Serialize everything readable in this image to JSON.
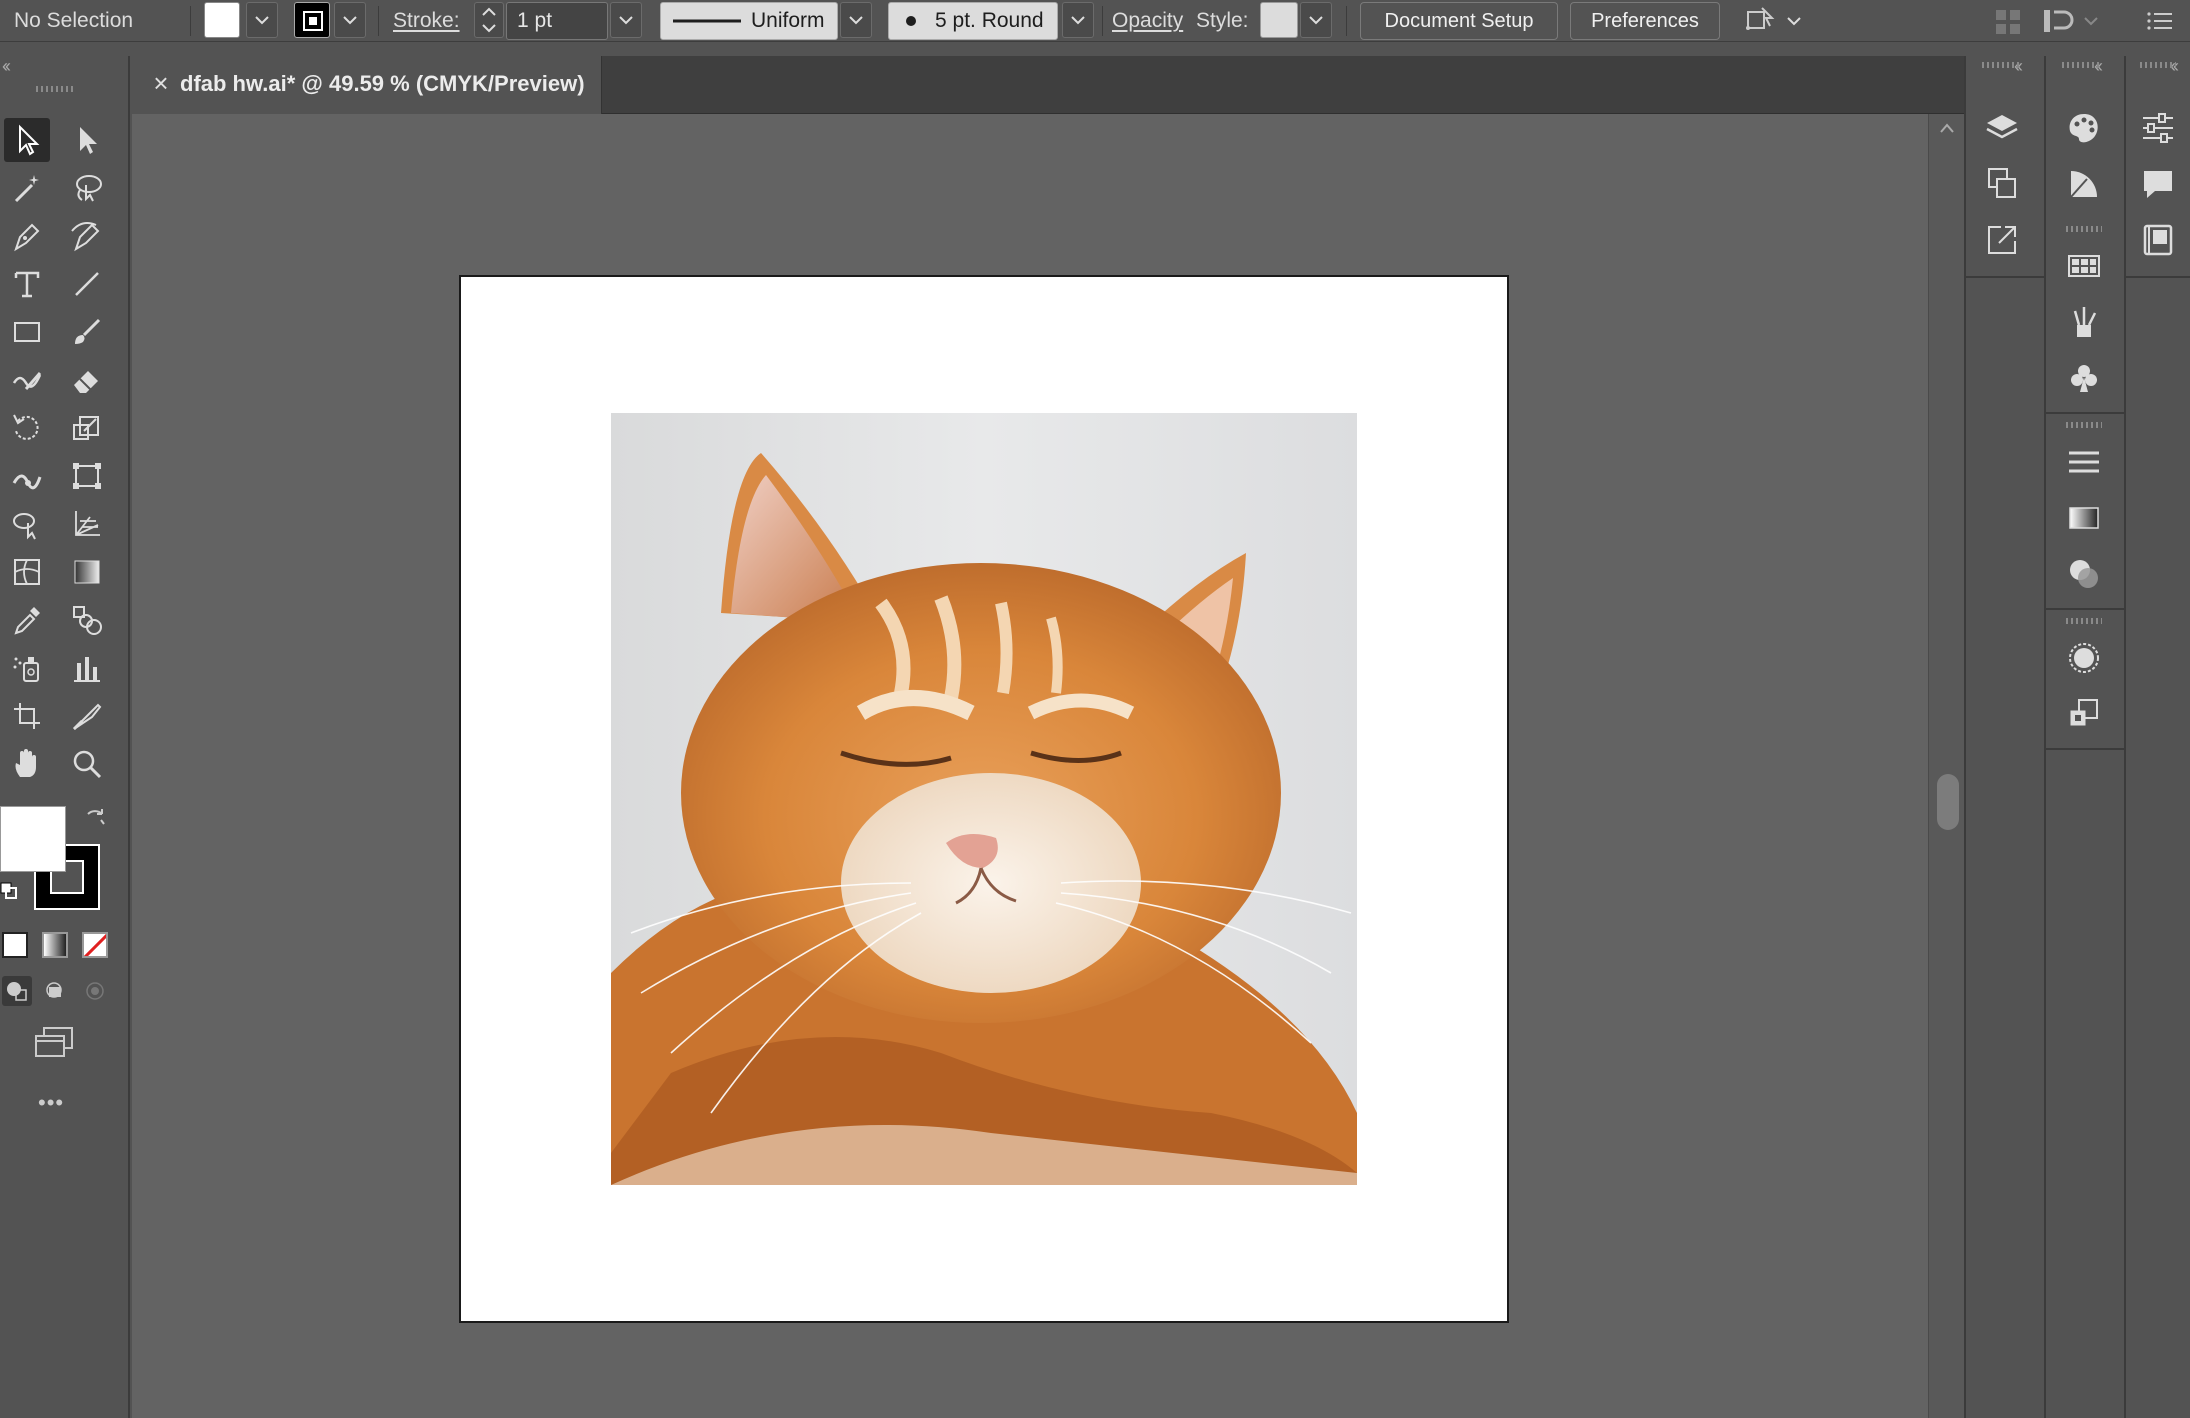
{
  "control_bar": {
    "selection_status": "No Selection",
    "fill_color": "#ffffff",
    "stroke_label": "Stroke:",
    "stroke_weight": "1 pt",
    "variable_width_profile": "Uniform",
    "brush_definition": "5 pt. Round",
    "opacity_label": "Opacity",
    "style_label": "Style:",
    "document_setup_label": "Document Setup",
    "preferences_label": "Preferences"
  },
  "document_tab": {
    "title": "dfab hw.ai* @ 49.59 % (CMYK/Preview)",
    "close_glyph": "×"
  },
  "toolbar": {
    "collapse_glyph": "‹‹",
    "more_tools_glyph": "•••",
    "tools": [
      {
        "name": "selection-tool",
        "icon": "black-arrow"
      },
      {
        "name": "direct-selection-tool",
        "icon": "white-arrow"
      },
      {
        "name": "magic-wand-tool",
        "icon": "magic-wand"
      },
      {
        "name": "lasso-tool",
        "icon": "lasso"
      },
      {
        "name": "pen-tool",
        "icon": "pen"
      },
      {
        "name": "curvature-tool",
        "icon": "curvature-pen"
      },
      {
        "name": "type-tool",
        "icon": "type-T"
      },
      {
        "name": "line-segment-tool",
        "icon": "line"
      },
      {
        "name": "rectangle-tool",
        "icon": "rectangle"
      },
      {
        "name": "paintbrush-tool",
        "icon": "brush"
      },
      {
        "name": "shaper-tool",
        "icon": "shaper"
      },
      {
        "name": "eraser-tool",
        "icon": "eraser"
      },
      {
        "name": "rotate-tool",
        "icon": "rotate"
      },
      {
        "name": "scale-tool",
        "icon": "scale"
      },
      {
        "name": "width-tool",
        "icon": "width"
      },
      {
        "name": "free-transform-tool",
        "icon": "free-transform"
      },
      {
        "name": "shape-builder-tool",
        "icon": "shape-builder"
      },
      {
        "name": "perspective-grid-tool",
        "icon": "perspective-grid"
      },
      {
        "name": "mesh-tool",
        "icon": "mesh"
      },
      {
        "name": "gradient-tool",
        "icon": "gradient"
      },
      {
        "name": "eyedropper-tool",
        "icon": "eyedropper"
      },
      {
        "name": "blend-tool",
        "icon": "blend"
      },
      {
        "name": "symbol-sprayer-tool",
        "icon": "symbol-sprayer"
      },
      {
        "name": "column-graph-tool",
        "icon": "column-graph"
      },
      {
        "name": "artboard-tool",
        "icon": "artboard"
      },
      {
        "name": "slice-tool",
        "icon": "knife"
      },
      {
        "name": "hand-tool",
        "icon": "hand"
      },
      {
        "name": "zoom-tool",
        "icon": "magnifier"
      }
    ],
    "fill_swatch": "#ffffff",
    "stroke_swatch": "#000000",
    "drawing_modes": [
      "draw-normal",
      "draw-behind",
      "draw-inside"
    ],
    "screen_mode": "change-screen-mode"
  },
  "colors": {
    "ui_background": "#535353",
    "canvas_background": "#636363",
    "artboard": "#ffffff",
    "tab_bar": "#3f3f3f",
    "accent_none": "#e02020"
  },
  "right_panels": {
    "column_1": [
      "layers-icon",
      "artboards-icon",
      "asset-export-icon"
    ],
    "column_2": [
      "color-icon",
      "color-guide-icon",
      "swatches-icon",
      "brushes-icon",
      "symbols-icon",
      "stroke-icon",
      "gradient-icon",
      "transparency-icon",
      "appearance-icon",
      "graphic-styles-icon"
    ],
    "column_3": [
      "properties-icon",
      "comments-icon",
      "libraries-icon"
    ],
    "collapse_glyph": "‹‹"
  }
}
